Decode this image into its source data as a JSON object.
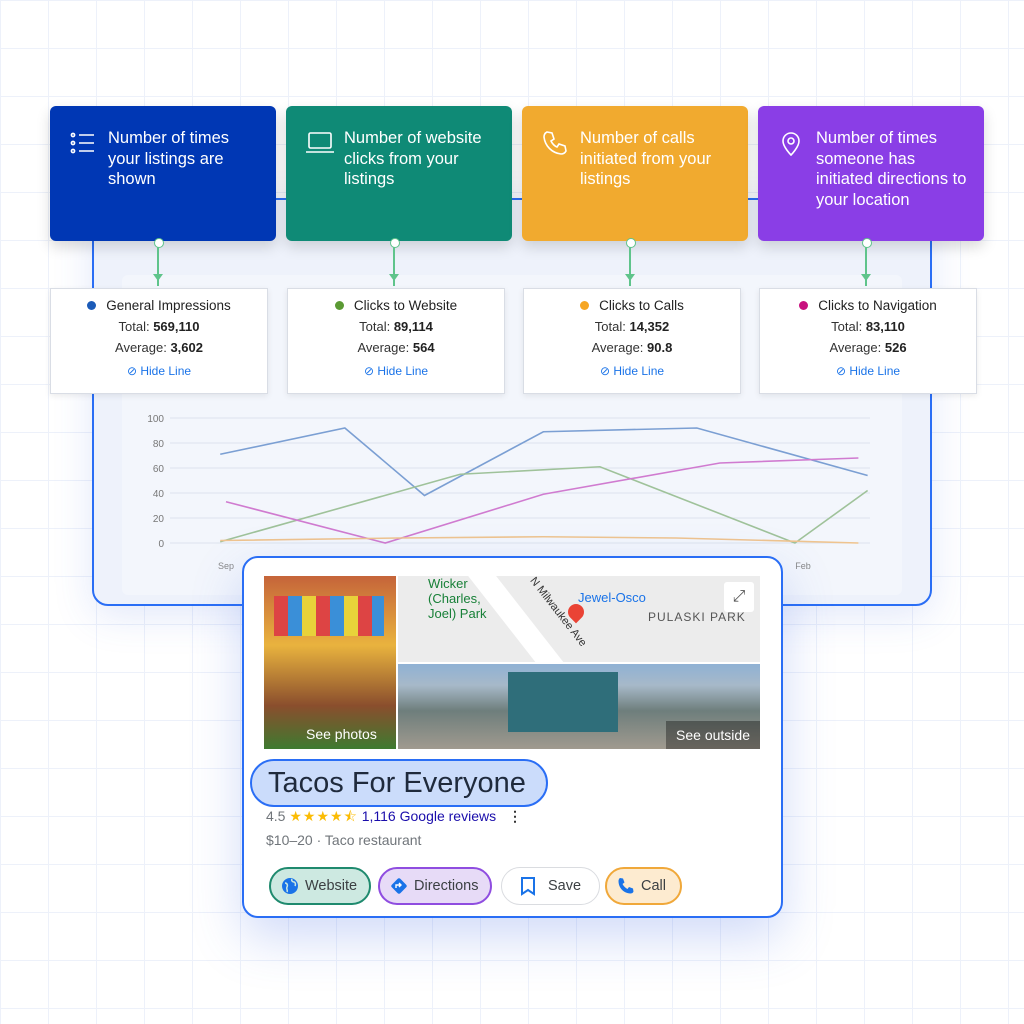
{
  "cards": [
    {
      "text": "Number of times your listings are shown",
      "color": "#0037b4",
      "icon": "list-icon"
    },
    {
      "text": "Number of website clicks from your listings",
      "color": "#0f8a76",
      "icon": "laptop-icon"
    },
    {
      "text": "Number of calls initiated from your listings",
      "color": "#f1aa2f",
      "icon": "phone-icon"
    },
    {
      "text": "Number of times someone has initiated directions to your location",
      "color": "#8a3ee6",
      "icon": "location-pin-icon"
    }
  ],
  "stats": [
    {
      "title": "General Impressions",
      "color": "#1c5bb8",
      "total_label": "Total:",
      "total": "569,110",
      "avg_label": "Average:",
      "avg": "3,602",
      "hide": "Hide Line"
    },
    {
      "title": "Clicks to Website",
      "color": "#5b9a34",
      "total_label": "Total:",
      "total": "89,114",
      "avg_label": "Average:",
      "avg": "564",
      "hide": "Hide Line"
    },
    {
      "title": "Clicks to Calls",
      "color": "#f6a623",
      "total_label": "Total:",
      "total": "14,352",
      "avg_label": "Average:",
      "avg": "90.8",
      "hide": "Hide Line"
    },
    {
      "title": "Clicks to Navigation",
      "color": "#c8127f",
      "total_label": "Total:",
      "total": "83,110",
      "avg_label": "Average:",
      "avg": "526",
      "hide": "Hide Line"
    }
  ],
  "chart_data": {
    "type": "line",
    "ylim": [
      0,
      100
    ],
    "yticks": [
      0,
      20,
      40,
      60,
      80,
      100
    ],
    "xticks": [
      {
        "x": 0,
        "label": "Sep"
      },
      {
        "x": 5,
        "label": "Feb"
      }
    ],
    "grid": true,
    "series": [
      {
        "key": "impressions",
        "color": "#7b9fd3",
        "points": [
          [
            -0.05,
            71
          ],
          [
            1.03,
            92
          ],
          [
            1.72,
            38
          ],
          [
            2.75,
            89
          ],
          [
            4.08,
            92
          ],
          [
            5.56,
            54
          ]
        ]
      },
      {
        "key": "website",
        "color": "#9fc29a",
        "points": [
          [
            -0.05,
            1
          ],
          [
            2.03,
            55
          ],
          [
            3.24,
            61
          ],
          [
            4.93,
            0
          ],
          [
            5.56,
            42
          ]
        ]
      },
      {
        "key": "navigation",
        "color": "#d07bd0",
        "points": [
          [
            0,
            33
          ],
          [
            1.38,
            0
          ],
          [
            2.75,
            39
          ],
          [
            4.28,
            64
          ],
          [
            5.48,
            68
          ]
        ]
      },
      {
        "key": "calls",
        "color": "#efc48f",
        "points": [
          [
            -0.05,
            2
          ],
          [
            1.5,
            4
          ],
          [
            2.75,
            5
          ],
          [
            3.9,
            4
          ],
          [
            5.48,
            0
          ]
        ]
      }
    ]
  },
  "listing": {
    "see_photos": "See photos",
    "see_outside": "See outside",
    "map_labels": [
      "Wicker (Charles, Joel) Park",
      "N Milwaukee Ave",
      "Jewel-Osco",
      "PULASKI PARK"
    ],
    "name": "Tacos For Everyone",
    "rating": "4.5",
    "stars": "★★★★⯪",
    "reviews": "1,116 Google reviews",
    "meta": "$10–20 · Taco restaurant",
    "buttons": [
      {
        "label": "Website",
        "icon": "globe-icon",
        "bg": "#cde9e1",
        "border": "#1f8a6e"
      },
      {
        "label": "Directions",
        "icon": "directions-icon",
        "bg": "#e7dbf7",
        "border": "#8f4de0"
      },
      {
        "label": "Save",
        "icon": "bookmark-icon",
        "bg": "#ffffff",
        "border": "#dadce0"
      },
      {
        "label": "Call",
        "icon": "phone-icon",
        "bg": "#fdebd0",
        "border": "#f0a83a"
      }
    ]
  }
}
